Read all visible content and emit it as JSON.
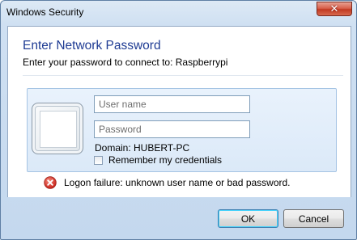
{
  "window": {
    "title": "Windows Security",
    "close_symbol": "✕"
  },
  "dialog": {
    "heading": "Enter Network Password",
    "subheading": "Enter your password to connect to: Raspberrypi"
  },
  "credentials": {
    "username_placeholder": "User name",
    "username_value": "",
    "password_placeholder": "Password",
    "password_value": "",
    "domain_text": "Domain: HUBERT-PC",
    "remember_label": "Remember my credentials",
    "remember_checked": false
  },
  "error": {
    "icon": "error-icon",
    "message": "Logon failure: unknown user name or bad password."
  },
  "buttons": {
    "ok_label": "OK",
    "cancel_label": "Cancel"
  },
  "colors": {
    "heading": "#1e3b93",
    "frame": "#cfe0f2",
    "close": "#c23a22",
    "error": "#d63b2a"
  }
}
